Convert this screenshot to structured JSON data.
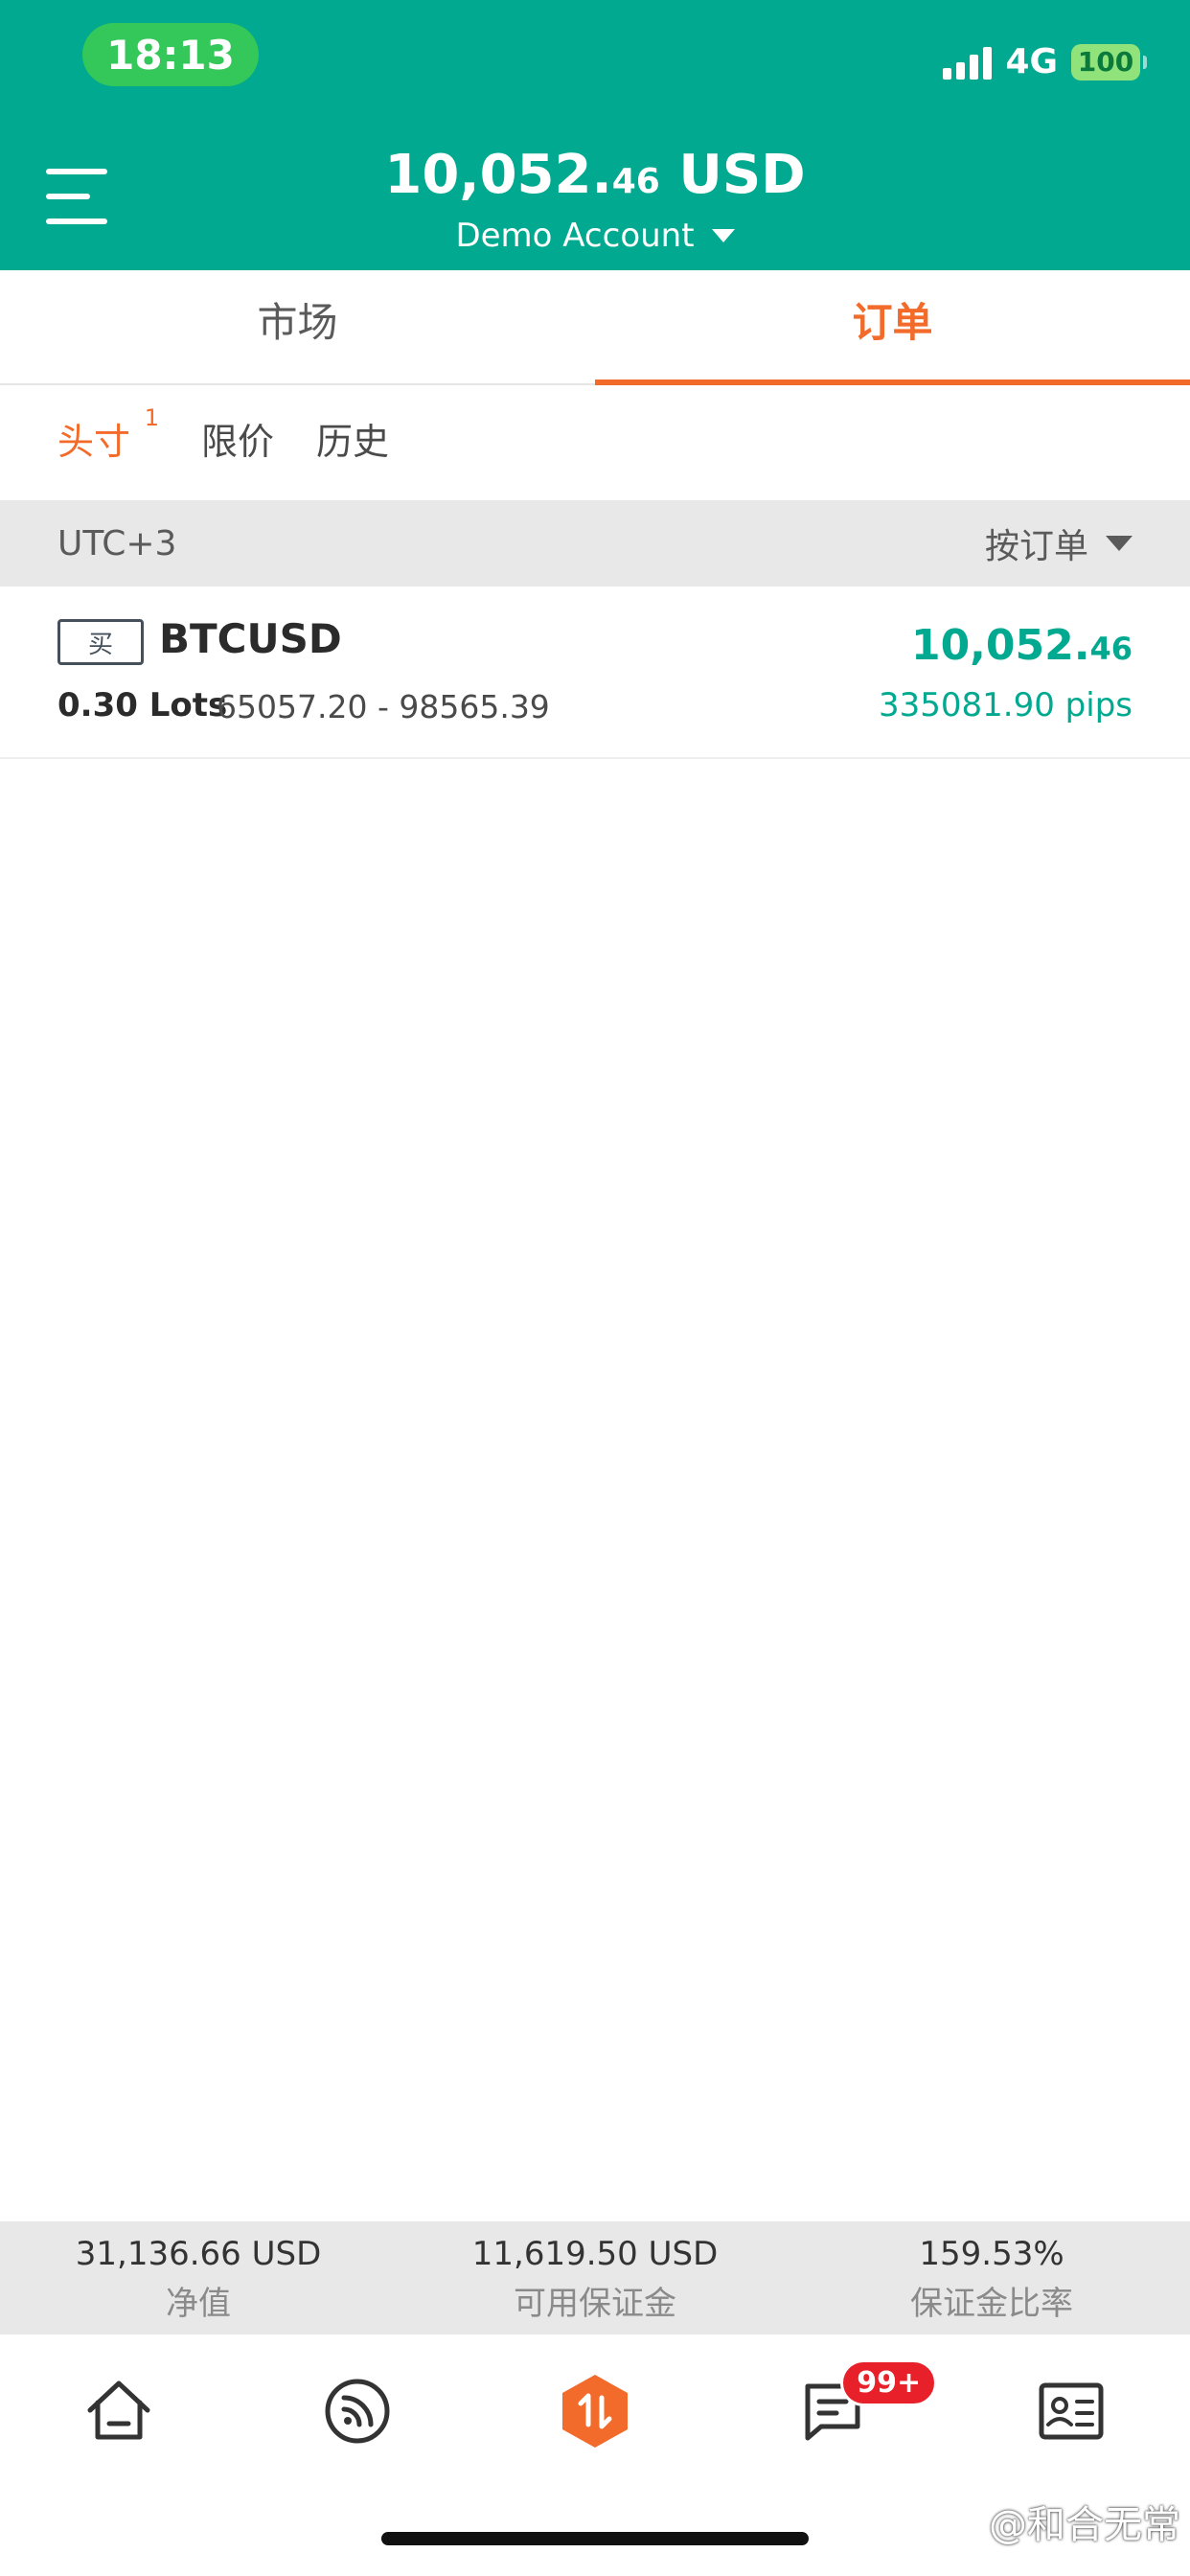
{
  "status_bar": {
    "time": "18:13",
    "network": "4G",
    "battery": "100"
  },
  "header": {
    "balance_int": "10,052.",
    "balance_dec": "46",
    "currency": "USD",
    "account": "Demo Account"
  },
  "tabs": [
    {
      "label": "市场",
      "active": false
    },
    {
      "label": "订单",
      "active": true
    }
  ],
  "subtabs": [
    {
      "label": "头寸",
      "count": "1",
      "active": true
    },
    {
      "label": "限价"
    },
    {
      "label": "历史"
    }
  ],
  "filter": {
    "timezone": "UTC+3",
    "sort_label": "按订单"
  },
  "orders": [
    {
      "side": "买",
      "symbol": "BTCUSD",
      "lots": "0.30 Lots",
      "range": "65057.20 - 98565.39",
      "pl_int": "10,052.",
      "pl_dec": "46",
      "pips": "335081.90 pips"
    }
  ],
  "stats": [
    {
      "value": "31,136.66 USD",
      "label": "净值"
    },
    {
      "value": "11,619.50 USD",
      "label": "可用保证金"
    },
    {
      "value": "159.53%",
      "label": "保证金比率"
    }
  ],
  "nav": {
    "items": [
      "home-icon",
      "feed-icon",
      "trade-icon",
      "messages-icon",
      "profile-card-icon"
    ],
    "messages_badge": "99+"
  },
  "watermark": "@和合无常",
  "colors": {
    "brand": "#00a98f",
    "accent": "#f26b2a",
    "badge": "#e8202a"
  }
}
